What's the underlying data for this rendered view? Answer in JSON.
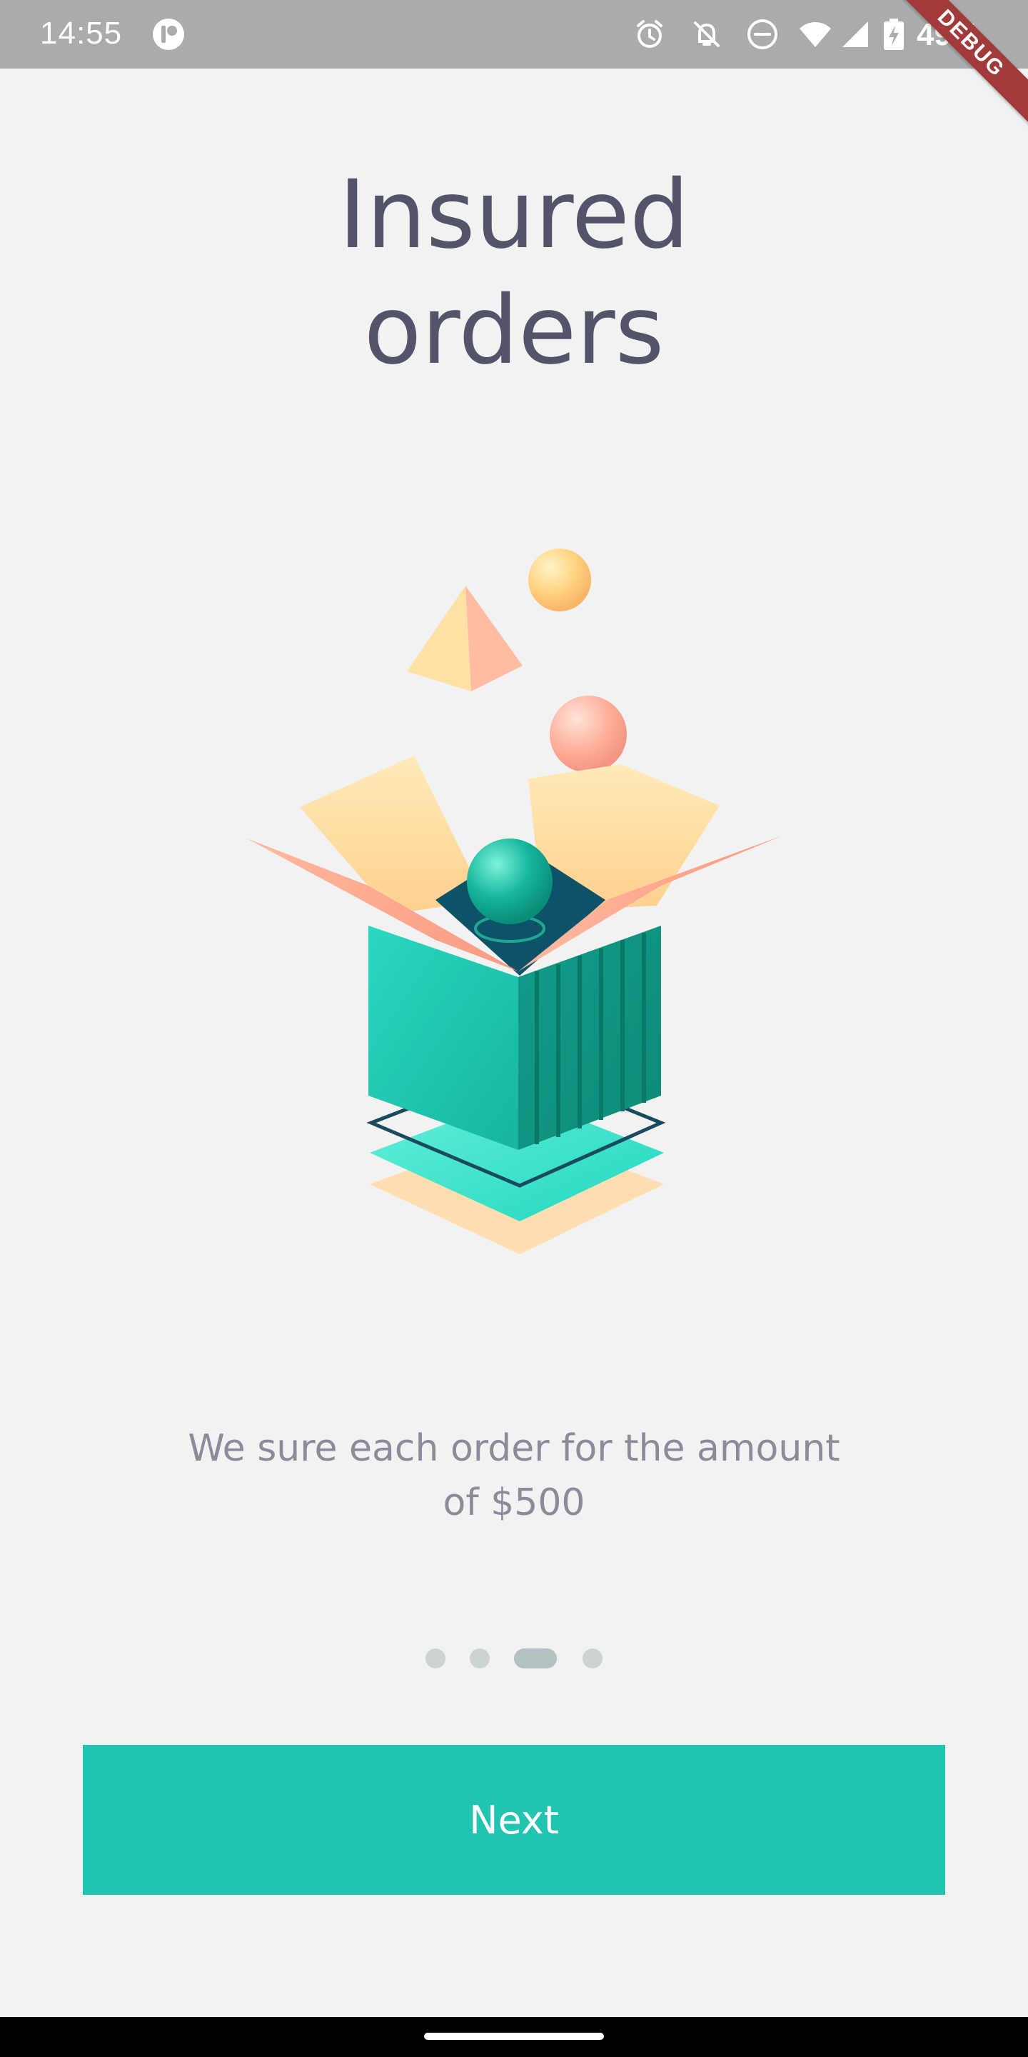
{
  "status_bar": {
    "time": "14:55",
    "battery": "49%",
    "icons": [
      "app-icon",
      "alarm-icon",
      "notifications-off-icon",
      "do-not-disturb-icon",
      "wifi-icon",
      "signal-icon",
      "battery-charging-icon"
    ]
  },
  "debug_ribbon": {
    "label": "DEBUG"
  },
  "onboarding": {
    "title_line1": "Insured",
    "title_line2": "orders",
    "illustration": "open-box-illustration",
    "description_line1": "We sure each order for the amount",
    "description_line2": "of $500",
    "pages_total": 4,
    "current_page": 3,
    "next_label": "Next"
  },
  "colors": {
    "background": "#f2f2f2",
    "status_bar": "#ababab",
    "title": "#52546a",
    "description": "#8a8c9a",
    "accent": "#21c4b0",
    "dot_inactive": "#ccd3d3",
    "dot_active": "#b5c0c3",
    "ribbon": "#a13a3a"
  }
}
